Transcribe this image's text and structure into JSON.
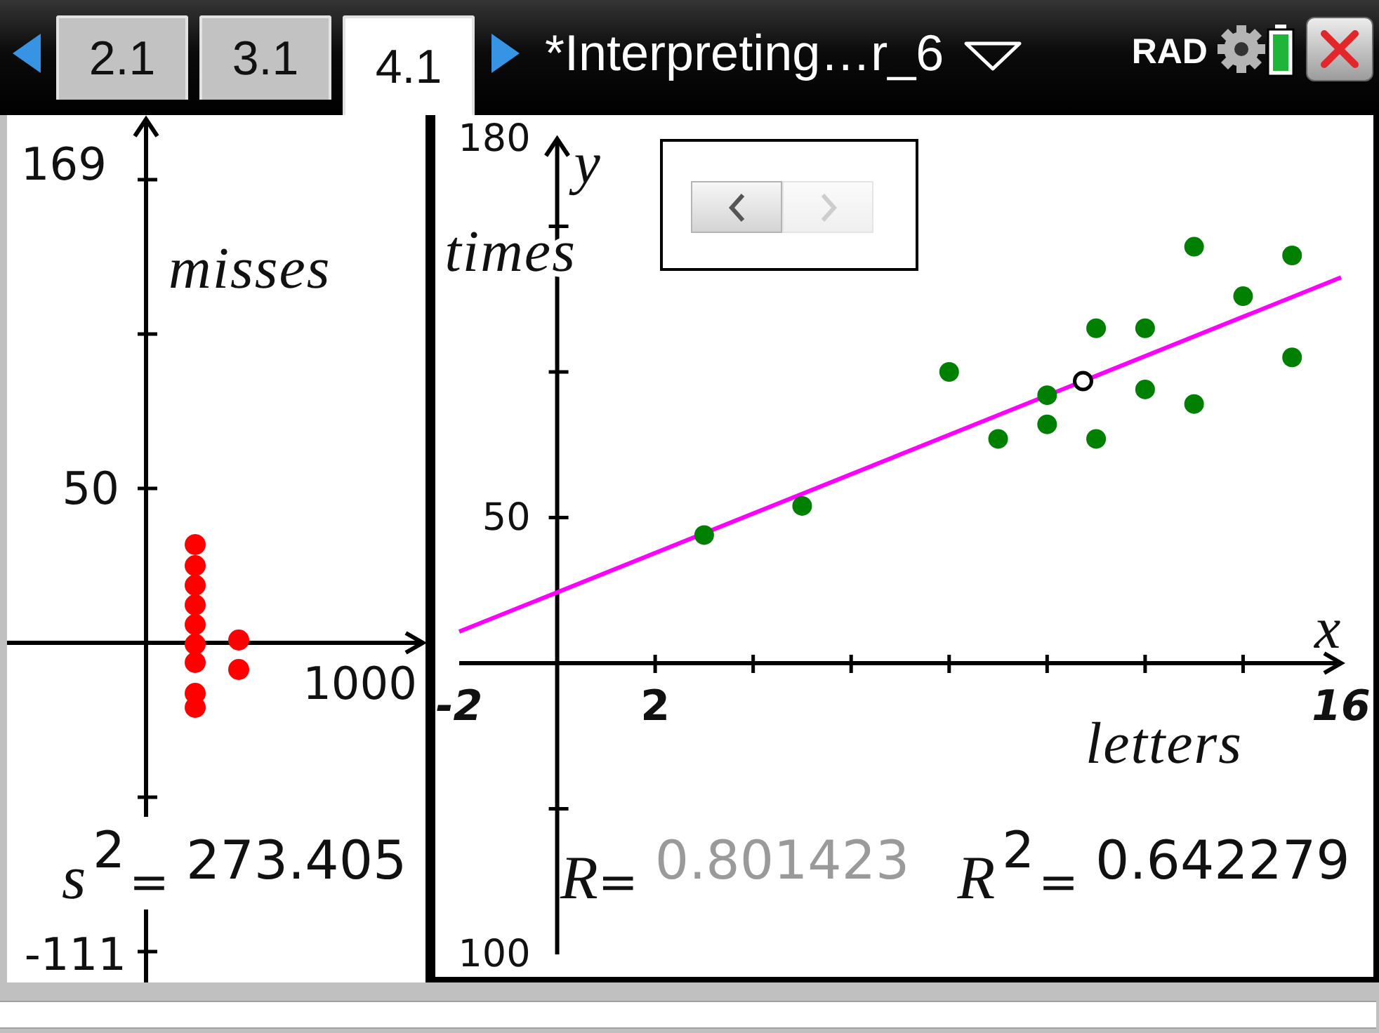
{
  "toolbar": {
    "tabs": [
      {
        "label": "2.1",
        "selected": false
      },
      {
        "label": "3.1",
        "selected": false
      },
      {
        "label": "4.1",
        "selected": true
      }
    ],
    "document_title": "*Interpreting…r_6",
    "angle_mode": "RAD"
  },
  "left_panel": {
    "selected": false,
    "plot": {
      "y_tick_labels": [
        "169",
        "50",
        "-111"
      ],
      "x_end_label": "1000",
      "y_axis_title": "misses"
    },
    "stat": {
      "label": "*s*$^{2}$=",
      "value": "273.405"
    }
  },
  "right_panel": {
    "selected": true,
    "chart_data": {
      "type": "scatter",
      "xlabel": "letters",
      "ylabel": "times",
      "xlim": [
        -2,
        16
      ],
      "ylim": [
        -100,
        180
      ],
      "xticks": [
        -2,
        2,
        16
      ],
      "yticks": [
        180,
        50,
        {
          "value": -100,
          "label": "100"
        }
      ],
      "x": [
        3,
        5,
        8,
        9,
        10,
        10,
        11,
        11,
        12,
        12,
        13,
        13,
        14,
        15,
        15
      ],
      "series": [
        {
          "color": "#008000",
          "values": [
            44,
            54,
            100,
            77,
            92,
            82,
            115,
            77,
            115,
            94,
            143,
            89,
            126,
            140,
            105
          ]
        }
      ]
    },
    "axis_names": {
      "x": "x",
      "y": "y"
    },
    "regression_line": true,
    "mean_point": true,
    "pager": [
      {
        "kind": "previous",
        "disabled": false
      },
      {
        "kind": "next",
        "disabled": true
      }
    ],
    "stats": [
      {
        "label": "*R*=",
        "value": "0.801423",
        "dimmed": true
      },
      {
        "label": "*R*$^{2}$=",
        "value": "0.642279",
        "dimmed": false
      }
    ]
  }
}
